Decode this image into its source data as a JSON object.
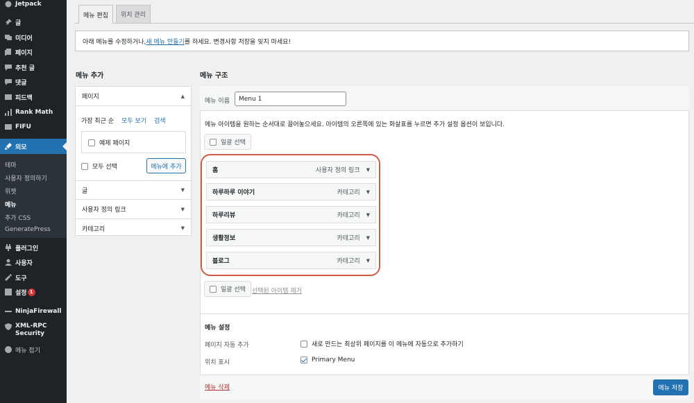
{
  "sidebar": {
    "jetpack": "Jetpack",
    "posts": "글",
    "media": "미디어",
    "pages": "페이지",
    "recommend": "추천 글",
    "comments": "댓글",
    "feedback": "피드백",
    "rankmath": "Rank Math",
    "fifu": "FIFU",
    "appearance": "외모",
    "sub": {
      "theme": "테마",
      "customize": "사용자 정의하기",
      "widgets": "위젯",
      "menus": "메뉴",
      "css": "추가 CSS",
      "generatepress": "GeneratePress"
    },
    "plugins": "플러그인",
    "users": "사용자",
    "tools": "도구",
    "settings": "설정",
    "settings_badge": "1",
    "ninjafirewall": "NinjaFirewall",
    "xmlrpc_1": "XML-RPC",
    "xmlrpc_2": "Security",
    "collapse": "메뉴 접기"
  },
  "tabs": {
    "edit": "메뉴 편집",
    "locations": "위치 관리"
  },
  "notice": {
    "before": "아래 메뉴를 수정하거나, ",
    "link": "새 메뉴 만들기",
    "after": "를 하세요. 변경사항 저장을 잊지 마세요!"
  },
  "add_menu": {
    "title": "메뉴 추가",
    "pages_head": "페이지",
    "tab_recent": "가장 최근 순",
    "tab_all": "모두 보기",
    "tab_search": "검색",
    "sample_page": "예제 페이지",
    "select_all": "모두 선택",
    "add_button": "메뉴에 추가",
    "posts_head": "글",
    "custom_links_head": "사용자 정의 링크",
    "categories_head": "카테고리"
  },
  "structure": {
    "title": "메뉴 구조",
    "name_label": "메뉴 이름",
    "name_value": "Menu 1",
    "instructions": "메뉴 아이템을 원하는 순서대로 끌어놓으세요. 아이템의 오른쪽에 있는 화살표를 누르면 추가 설정 옵션이 보입니다.",
    "bulk_select": "일괄 선택",
    "remove_selected": "선택된 아이템 제거",
    "items": [
      {
        "title": "홈",
        "type": "사용자 정의 링크"
      },
      {
        "title": "하루하루 이야기",
        "type": "카테고리"
      },
      {
        "title": "하루리뷰",
        "type": "카테고리"
      },
      {
        "title": "생활정보",
        "type": "카테고리"
      },
      {
        "title": "블로그",
        "type": "카테고리"
      }
    ]
  },
  "settings": {
    "title": "메뉴 설정",
    "auto_add_label": "페이지 자동 추가",
    "auto_add_text": "새로 만드는 최상위 페이지를 이 메뉴에 자동으로 추가하기",
    "location_label": "위치 표시",
    "location_text": "Primary Menu"
  },
  "footer": {
    "delete": "메뉴 삭제",
    "save": "메뉴 저장"
  }
}
